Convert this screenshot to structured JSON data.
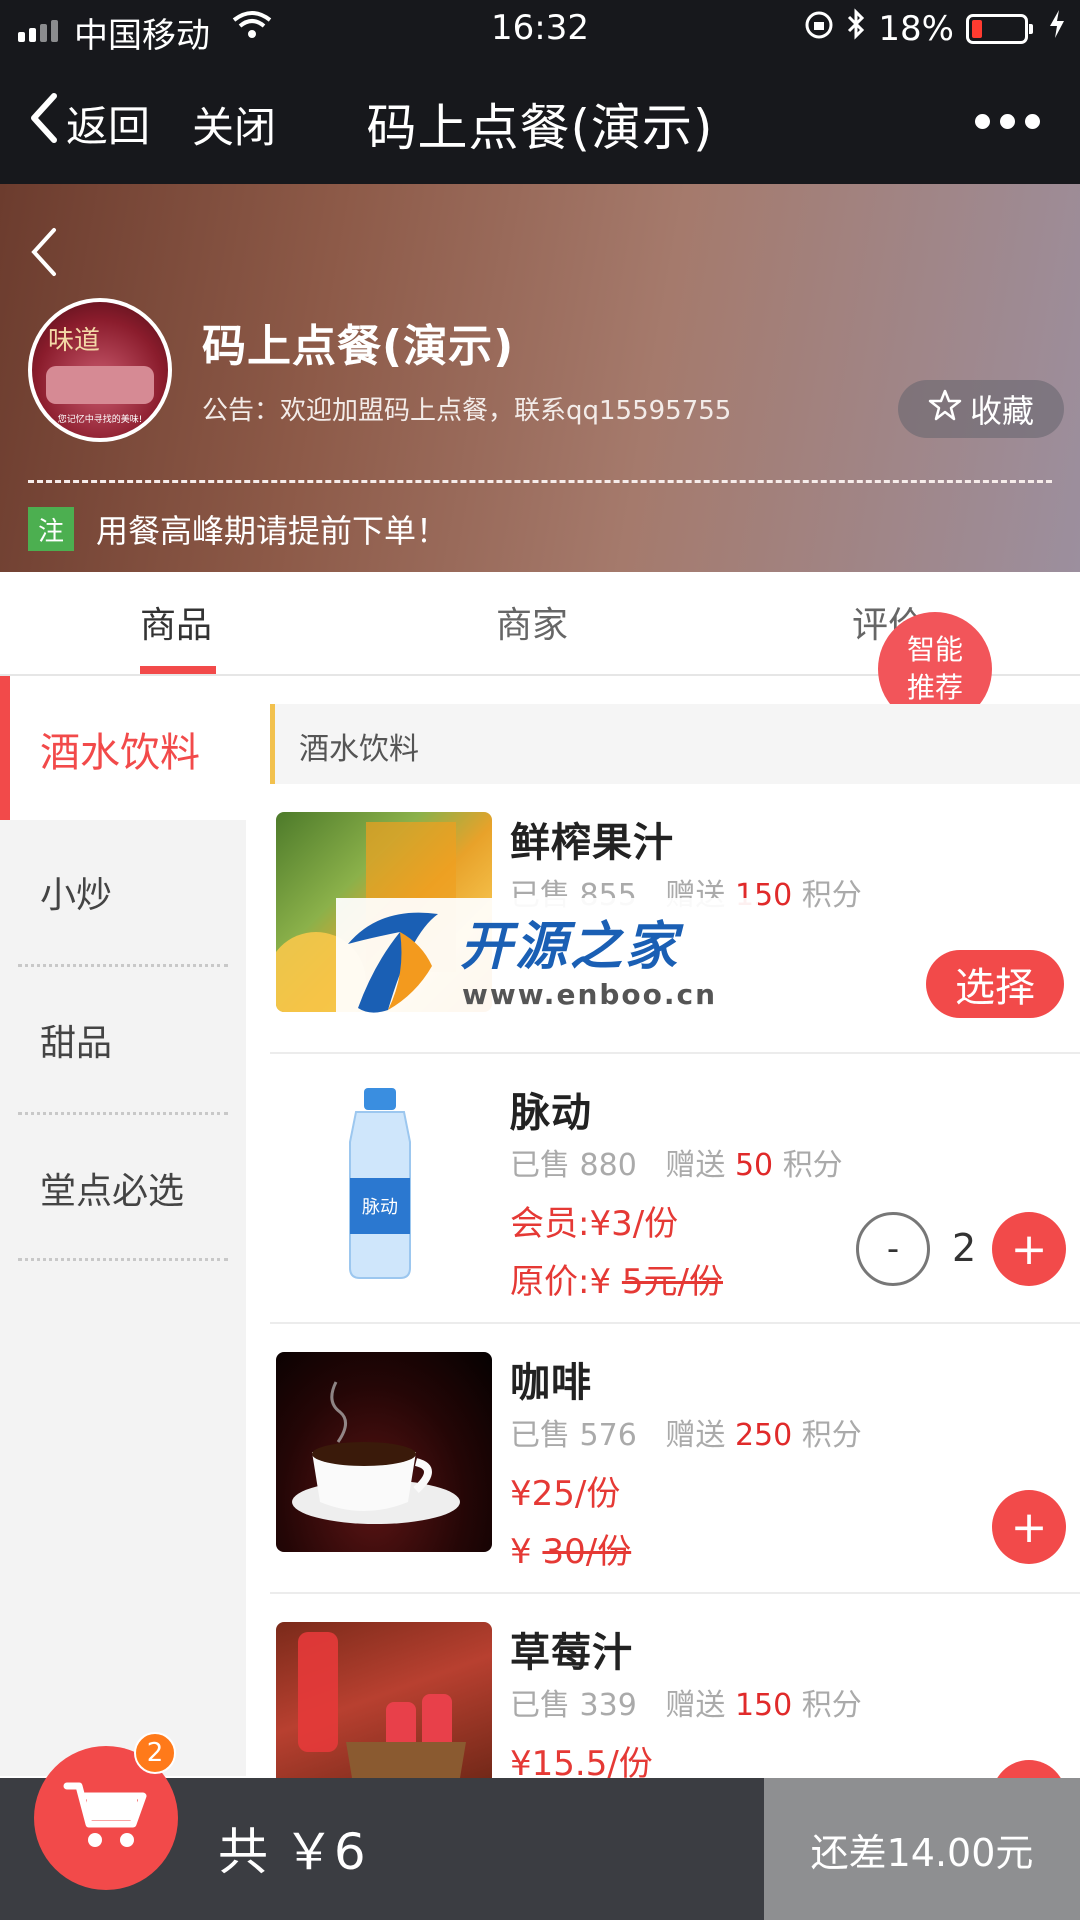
{
  "status_bar": {
    "carrier": "中国移动",
    "time": "16:32",
    "battery": "18%"
  },
  "nav": {
    "back_label": "返回",
    "close_label": "关闭",
    "title": "码上点餐(演示)"
  },
  "shop": {
    "name": "码上点餐(演示)",
    "notice": "公告：欢迎加盟码上点餐，联系qq15595755",
    "favorite_label": "收藏",
    "tip_tag": "注",
    "tip_text": "用餐高峰期请提前下单！",
    "logo_text": "味道",
    "logo_slogan": "您记忆中寻找的美味!"
  },
  "tabs": [
    "商品",
    "商家",
    "评价"
  ],
  "recommend": {
    "line1": "智能",
    "line2": "推荐"
  },
  "categories": [
    "酒水饮料",
    "小炒",
    "甜品",
    "堂点必选"
  ],
  "section_title": "酒水饮料",
  "products": [
    {
      "name": "鲜榨果汁",
      "sold_label": "已售 855",
      "gift_label": "赠送",
      "points": "150",
      "points_unit": "积分",
      "action": "选择"
    },
    {
      "name": "脉动",
      "sold_label": "已售 880",
      "gift_label": "赠送",
      "points": "50",
      "points_unit": "积分",
      "member_price": "会员:¥3/份",
      "orig_prefix": "原价:¥ ",
      "orig_price": "5元/份",
      "quantity": "2",
      "minus": "-",
      "plus": "+"
    },
    {
      "name": "咖啡",
      "sold_label": "已售 576",
      "gift_label": "赠送",
      "points": "250",
      "points_unit": "积分",
      "price": "¥25/份",
      "orig_prefix": "¥ ",
      "orig_price": "30/份",
      "plus": "+"
    },
    {
      "name": "草莓汁",
      "sold_label": "已售 339",
      "gift_label": "赠送",
      "points": "150",
      "points_unit": "积分",
      "price": "¥15.5/份"
    }
  ],
  "watermark": {
    "title": "开源之家",
    "url": "www.enboo.cn"
  },
  "cart": {
    "badge": "2",
    "total": "共 ￥6",
    "checkout": "还差14.00元"
  },
  "colors": {
    "accent": "#f24a4a",
    "topbar": "#17181c",
    "cartbar": "#3b3d42",
    "badge": "#ff7a1a",
    "tip_tag": "#4caf50"
  }
}
